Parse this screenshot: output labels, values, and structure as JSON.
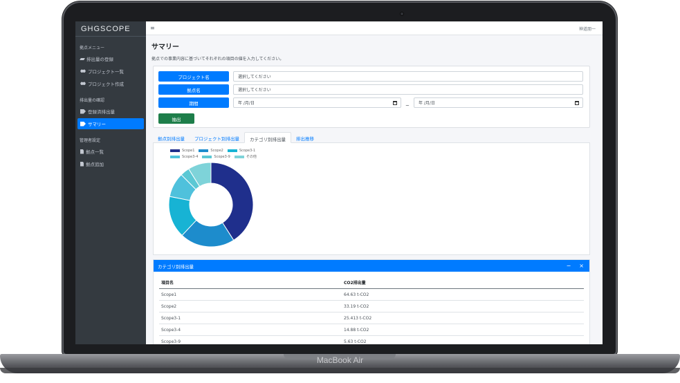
{
  "device": {
    "brand": "MacBook Air"
  },
  "sidebar": {
    "brand": "GHGSCOPE",
    "sections": [
      {
        "title": "拠点メニュー",
        "items": [
          {
            "label": "排出量の登録",
            "icon": "pencil-icon"
          },
          {
            "label": "プロジェクト一覧",
            "icon": "users-icon"
          },
          {
            "label": "プロジェクト作成",
            "icon": "users-icon"
          }
        ]
      },
      {
        "title": "排出量の確認",
        "items": [
          {
            "label": "登録済排出量",
            "icon": "tag-icon"
          },
          {
            "label": "サマリー",
            "icon": "tag-icon",
            "active": true
          }
        ]
      },
      {
        "title": "管理者設定",
        "items": [
          {
            "label": "拠点一覧",
            "icon": "file-icon"
          },
          {
            "label": "拠点追加",
            "icon": "file-icon"
          }
        ]
      }
    ]
  },
  "topbar": {
    "menu_icon": "≡",
    "user": "神道朋一"
  },
  "page": {
    "title": "サマリー",
    "description": "拠点での事業内容に基づいてそれぞれの項目の値を入力してください。"
  },
  "filters": {
    "project_label": "プロジェクト名",
    "project_value": "選択してください",
    "site_label": "拠点名",
    "site_value": "選択してください",
    "period_label": "期間",
    "period_start": "年 /月/日",
    "period_end": "年 /月/日",
    "period_separator": "~",
    "extract_label": "抽出"
  },
  "tabs": [
    {
      "label": "拠点別排出量",
      "active": false
    },
    {
      "label": "プロジェクト別排出量",
      "active": false
    },
    {
      "label": "カテゴリ別排出量",
      "active": true
    },
    {
      "label": "排出推移",
      "active": false
    }
  ],
  "chart_data": {
    "type": "pie",
    "categories": [
      "Scope1",
      "Scope2",
      "Scope3-1",
      "Scope3-4",
      "Scope3-9",
      "その他"
    ],
    "values": [
      64.63,
      33.19,
      25.413,
      14.88,
      5.63,
      14.0
    ],
    "colors": [
      "#1f2f8c",
      "#1d8ccc",
      "#17b3d4",
      "#4fc1dc",
      "#5bc8d4",
      "#7ed3d9"
    ],
    "donut": true,
    "legend": "top"
  },
  "table": {
    "title": "カテゴリ別排出量",
    "minimize_icon": "−",
    "close_icon": "×",
    "headers": [
      "項目名",
      "CO2排出量"
    ],
    "rows": [
      [
        "Scope1",
        "64.63 t-CO2"
      ],
      [
        "Scope2",
        "33.19 t-CO2"
      ],
      [
        "Scope3-1",
        "25.413 t-CO2"
      ],
      [
        "Scope3-4",
        "14.88 t-CO2"
      ],
      [
        "Scope3-9",
        "5.63 t-CO2"
      ]
    ]
  }
}
